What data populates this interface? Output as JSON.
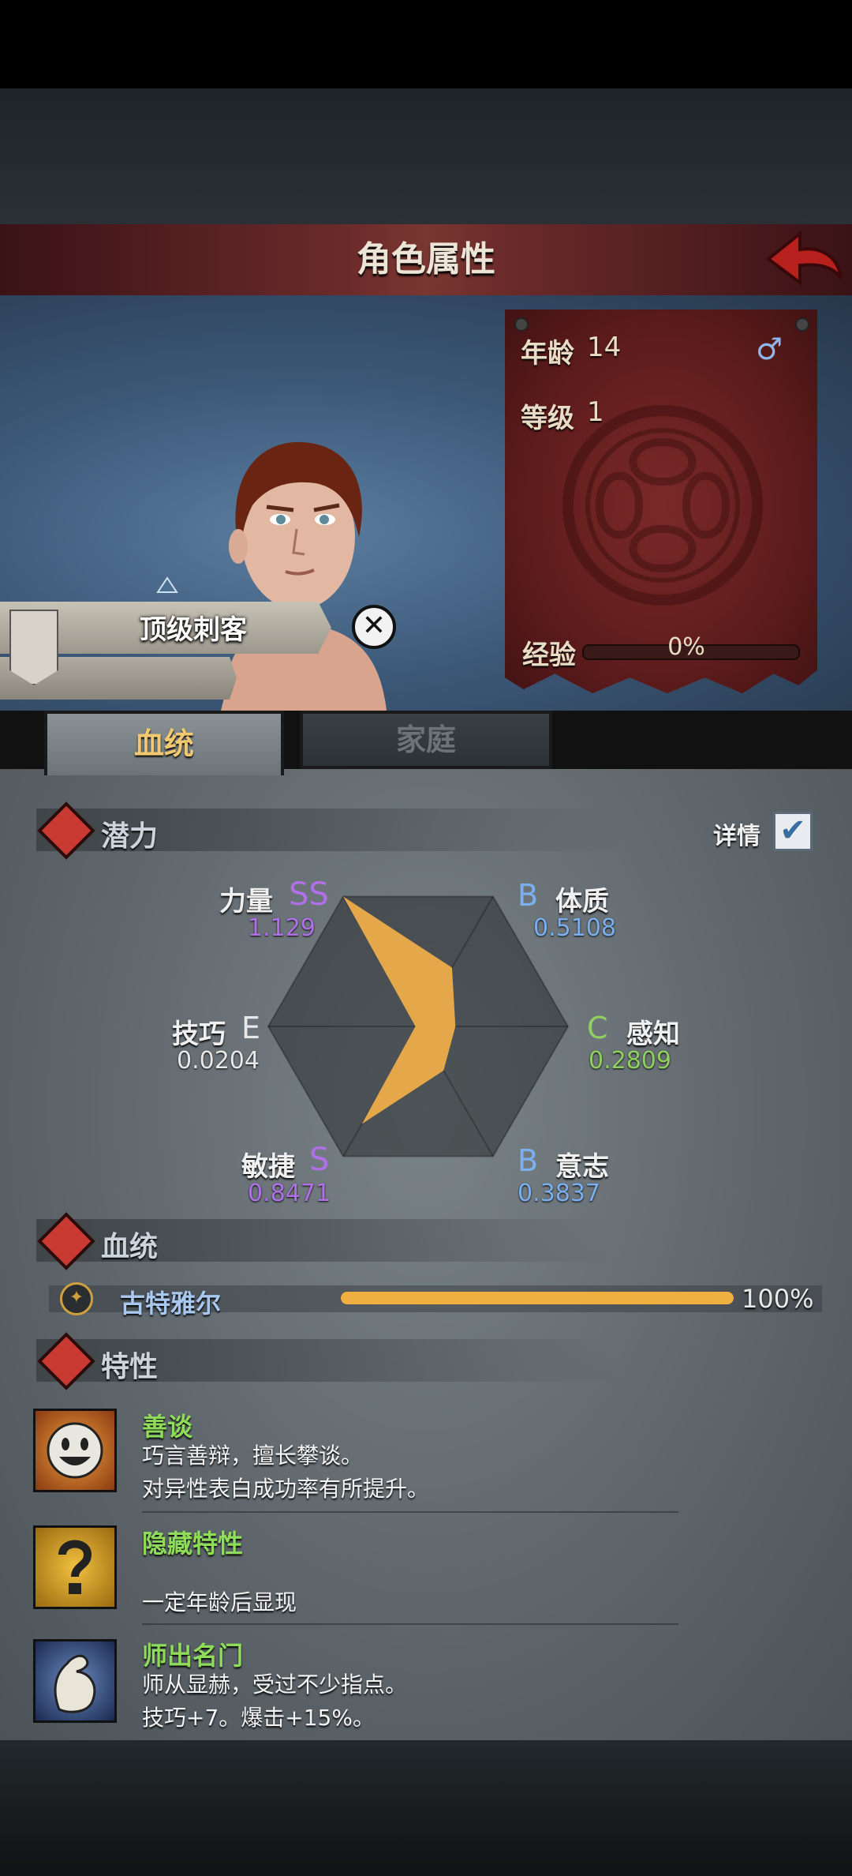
{
  "header": {
    "title": "角色属性"
  },
  "profile": {
    "class_name": "顶级刺客",
    "age_label": "年龄",
    "age": "14",
    "level_label": "等级",
    "level": "1",
    "exp_label": "经验",
    "exp": "0%",
    "exp_fraction": 0,
    "gender_icon": "♂"
  },
  "tabs": [
    {
      "label": "血统",
      "active": true
    },
    {
      "label": "家庭",
      "active": false
    }
  ],
  "potential": {
    "title": "潜力",
    "details_label": "详情",
    "details_checked": true,
    "check_glyph": "✔",
    "stats": [
      {
        "name": "力量",
        "grade": "SS",
        "value": "1.129",
        "color": "#b070e8"
      },
      {
        "name": "体质",
        "grade": "B",
        "value": "0.5108",
        "color": "#7ab0f0"
      },
      {
        "name": "感知",
        "grade": "C",
        "value": "0.2809",
        "color": "#90d060"
      },
      {
        "name": "意志",
        "grade": "B",
        "value": "0.3837",
        "color": "#7ab0f0"
      },
      {
        "name": "敏捷",
        "grade": "S",
        "value": "0.8471",
        "color": "#b070e8"
      },
      {
        "name": "技巧",
        "grade": "E",
        "value": "0.0204",
        "color": "#e8e8e8"
      }
    ],
    "chart_values": [
      1.129,
      0.5108,
      0.2809,
      0.3837,
      0.8471,
      0.0204
    ],
    "fill_color": "#e4a84a"
  },
  "bloodline": {
    "title": "血统",
    "name": "古特雅尔",
    "percent": "100%",
    "fraction": 1.0,
    "bar_color": "#f0b040"
  },
  "traits": {
    "title": "特性",
    "items": [
      {
        "name": "善谈",
        "line1": "巧言善辩，擅长攀谈。",
        "line2": "对异性表白成功率有所提升。",
        "icon": "smile-icon"
      },
      {
        "name": "隐藏特性",
        "line1": "",
        "line2": "一定年龄后显现",
        "icon": "question-icon"
      },
      {
        "name": "师出名门",
        "line1": "师从显赫，受过不少指点。",
        "line2": "技巧+7。爆击+15%。",
        "icon": "arm-icon"
      }
    ]
  }
}
